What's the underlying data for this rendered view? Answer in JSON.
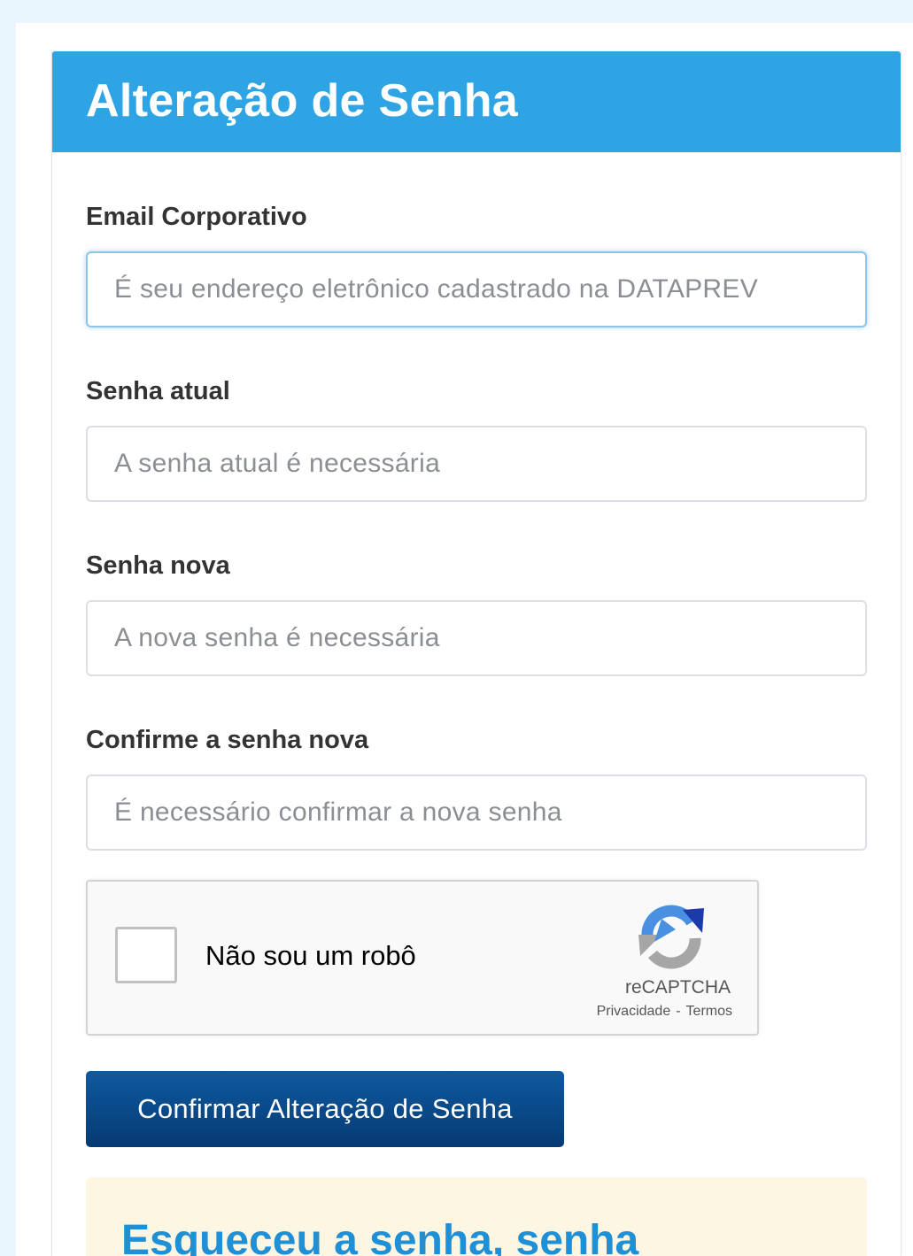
{
  "form": {
    "title": "Alteração de Senha",
    "header_color": "#2ea4e4",
    "fields": [
      {
        "label": "Email Corporativo",
        "placeholder": "É seu endereço eletrônico cadastrado na DATAPREV",
        "focused": true
      },
      {
        "label": "Senha atual",
        "placeholder": "A senha atual é necessária"
      },
      {
        "label": "Senha nova",
        "placeholder": "A nova senha é necessária"
      },
      {
        "label": "Confirme a senha nova",
        "placeholder": "É necessário confirmar a nova senha"
      }
    ],
    "submit_label": "Confirmar Alteração de Senha",
    "submit_color": "#0a4a8c"
  },
  "recaptcha": {
    "checkbox_label": "Não sou um robô",
    "brand": "reCAPTCHA",
    "privacy_label": "Privacidade",
    "separator": "-",
    "terms_label": "Termos",
    "checked": false
  },
  "forgot": {
    "title": "Esqueceu a senha, senha",
    "background": "#fcf6e3",
    "title_color": "#1f8fd6"
  }
}
